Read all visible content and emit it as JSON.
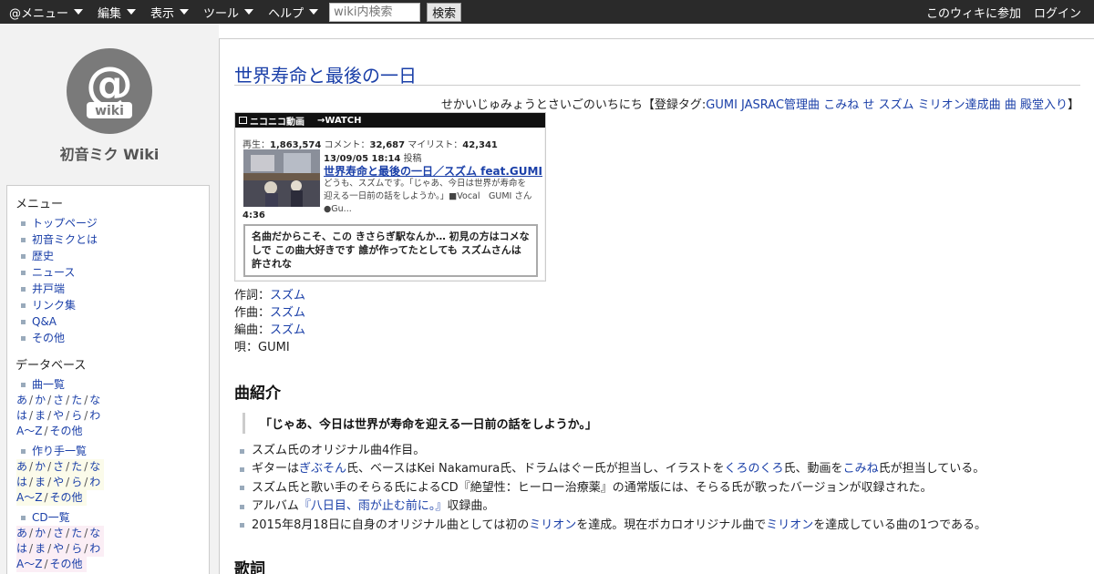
{
  "topbar": {
    "menus": [
      "@メニュー",
      "編集",
      "表示",
      "ツール",
      "ヘルプ"
    ],
    "search_placeholder": "wiki内検索",
    "search_button": "検索",
    "join": "このウィキに参加",
    "login": "ログイン"
  },
  "sidebar": {
    "logo_text": "wiki",
    "site_title": "初音ミク Wiki",
    "menu_heading": "メニュー",
    "menu_items": [
      "トップページ",
      "初音ミクとは",
      "歴史",
      "ニュース",
      "井戸端",
      "リンク集",
      "Q&A",
      "その他"
    ],
    "db_heading": "データベース",
    "songs_label": "曲一覧",
    "creators_label": "作り手一覧",
    "cd_label": "CD一覧",
    "kana_row1": [
      "あ",
      "か",
      "さ",
      "た",
      "な"
    ],
    "kana_row2": [
      "は",
      "ま",
      "や",
      "ら",
      "わ"
    ],
    "kana_row3": [
      "A～Z",
      "その他"
    ]
  },
  "main": {
    "title": "世界寿命と最後の一日",
    "reading_prefix": "せかいじゅみょうとさいごのいちにち【登録タグ:",
    "tags": [
      "GUMI",
      "JASRAC管理曲",
      "こみね",
      "せ",
      "スズム",
      "ミリオン達成曲",
      "曲",
      "殿堂入り"
    ],
    "reading_suffix": "】",
    "video": {
      "brand": "ニコニコ動画",
      "watch": "WATCH",
      "views_label": "再生：",
      "views": "1,863,574",
      "comments_label": "コメント：",
      "comments": "32,687",
      "mylist_label": "マイリスト：",
      "mylist": "42,341",
      "date": "13/09/05 18:14",
      "posted": "投稿",
      "title": "世界寿命と最後の一日／スズム feat.GUMI",
      "description": "どうも、スズムです。「じゃあ、今日は世界が寿命を迎える一日前の話をしようか。」■Vocal　GUMI さん●Gu...",
      "duration": "4:36",
      "top_comment": "名曲だからこそ、この きさらぎ駅なんか… 初見の方はコメなしで この曲大好きです 誰が作ってたとしても スズムさんは許されな"
    },
    "credits": {
      "lyrics_label": "作詞：",
      "lyrics": "スズム",
      "music_label": "作曲：",
      "music": "スズム",
      "arrange_label": "編曲：",
      "arrange": "スズム",
      "vocal_label": "唄：",
      "vocal": "GUMI"
    },
    "intro_heading": "曲紹介",
    "quote": "「じゃあ、今日は世界が寿命を迎える一日前の話をしようか。」",
    "bullets": {
      "b1": "スズム氏のオリジナル曲4作目。",
      "b2_a": "ギターは",
      "b2_link1": "ぎぶそん",
      "b2_b": "氏、ベースはKei Nakamura氏、ドラムはぐー氏が担当し、イラストを",
      "b2_link2": "くろのくろ",
      "b2_c": "氏、動画を",
      "b2_link3": "こみね",
      "b2_d": "氏が担当している。",
      "b3": "スズム氏と歌い手のそらる氏によるCD『絶望性：ヒーロー治療薬』の通常版には、そらる氏が歌ったバージョンが収録された。",
      "b4_a": "アルバム",
      "b4_link": "『八日目、雨が止む前に。』",
      "b4_b": "収録曲。",
      "b5_a": "2015年8月18日に自身のオリジナル曲としては初の",
      "b5_link1": "ミリオン",
      "b5_b": "を達成。現在ボカロオリジナル曲で",
      "b5_link2": "ミリオン",
      "b5_c": "を達成している曲の1つである。"
    },
    "lyrics_heading": "歌詞"
  },
  "colors": {
    "topbar": "#2a2a2a",
    "link": "#1a3fa8",
    "sidebar_bg": "#f2f2f2"
  }
}
